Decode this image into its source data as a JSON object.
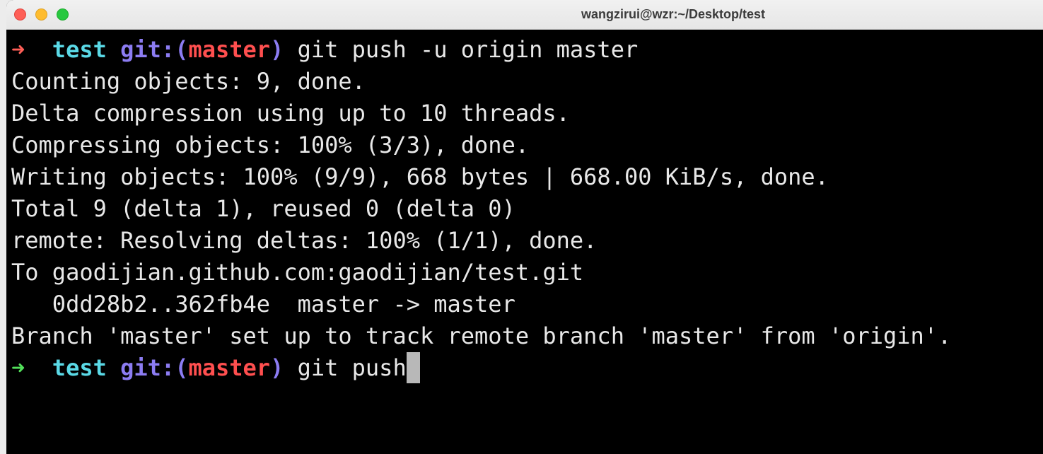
{
  "window": {
    "title": "wangzirui@wzr:~/Desktop/test"
  },
  "terminal": {
    "prompt_arrow": "➜",
    "dir": "test",
    "git_prefix": "git:(",
    "branch": "master",
    "git_suffix": ")",
    "command_1": "git push -u origin master",
    "output": [
      "Counting objects: 9, done.",
      "Delta compression using up to 10 threads.",
      "Compressing objects: 100% (3/3), done.",
      "Writing objects: 100% (9/9), 668 bytes | 668.00 KiB/s, done.",
      "Total 9 (delta 1), reused 0 (delta 0)",
      "remote: Resolving deltas: 100% (1/1), done.",
      "To gaodijian.github.com:gaodijian/test.git",
      "   0dd28b2..362fb4e  master -> master",
      "Branch 'master' set up to track remote branch 'master' from 'origin'."
    ],
    "command_2": "git push"
  },
  "colors": {
    "background": "#000000",
    "text": "#e8e8e8",
    "arrow_error": "#ff5f57",
    "arrow_ok": "#52e05a",
    "dir": "#5ad9e6",
    "git": "#8c7cf2",
    "branch": "#ff4f4f"
  },
  "icons": [
    "close-light-icon",
    "minimize-light-icon",
    "zoom-light-icon"
  ]
}
